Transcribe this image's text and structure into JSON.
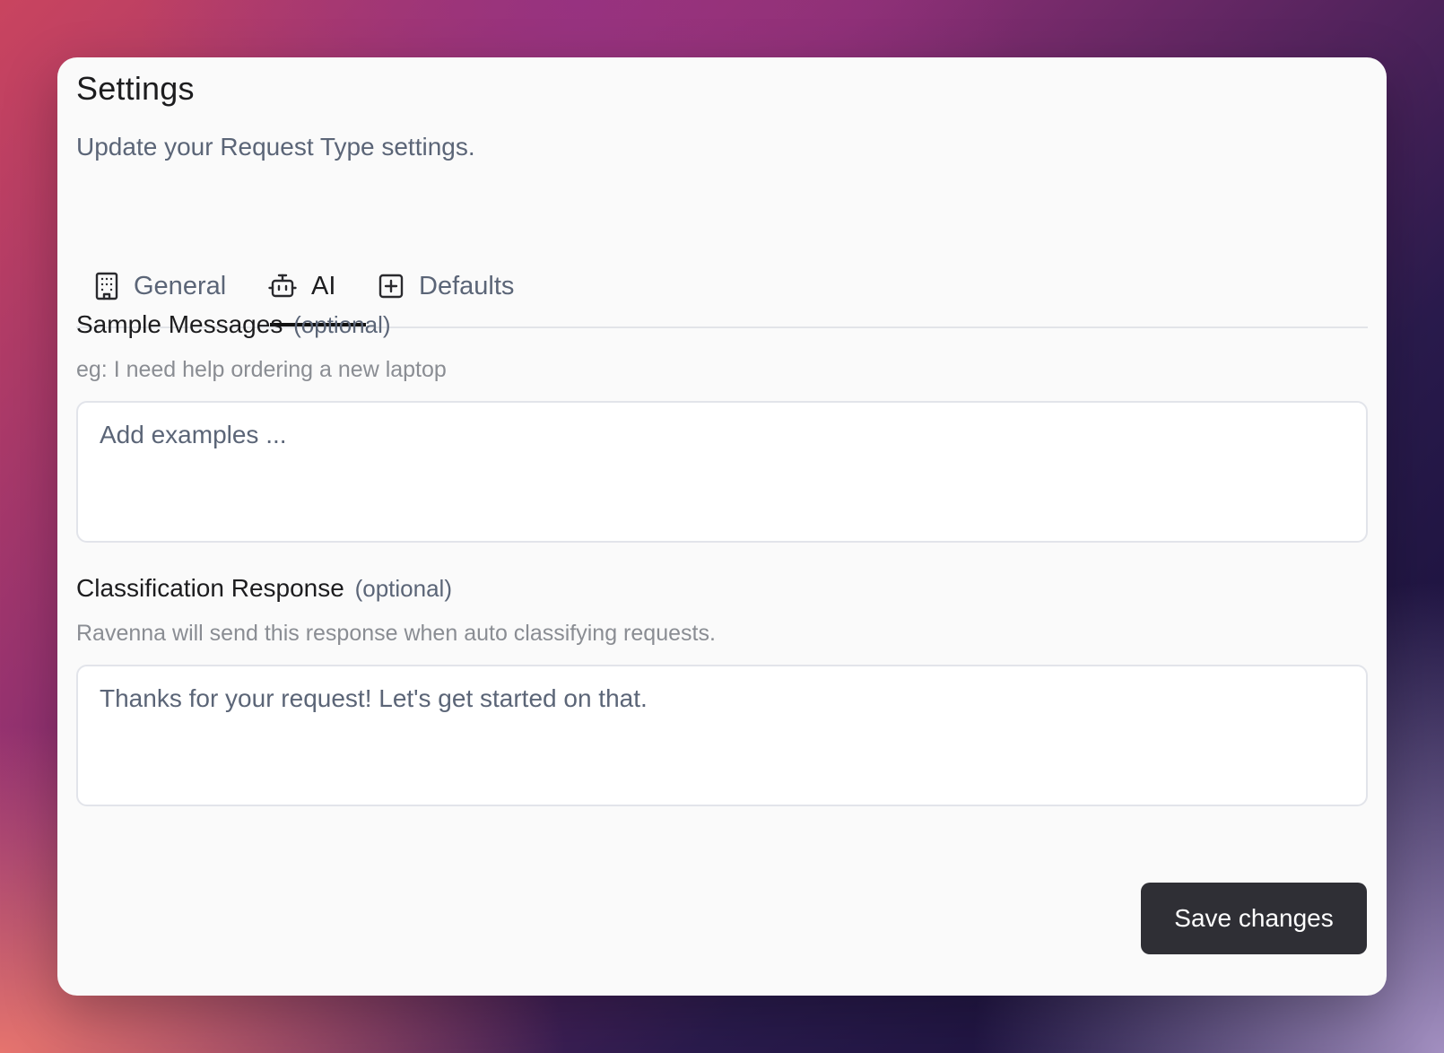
{
  "dialog": {
    "title": "Settings",
    "subtitle": "Update your Request Type settings."
  },
  "tabs": [
    {
      "label": "General",
      "icon": "building-icon",
      "active": false
    },
    {
      "label": "AI",
      "icon": "bot-icon",
      "active": true
    },
    {
      "label": "Defaults",
      "icon": "plus-square-icon",
      "active": false
    }
  ],
  "sample_messages": {
    "label": "Sample Messages",
    "optional": "(optional)",
    "help": "eg: I need help ordering a new laptop",
    "placeholder": "Add examples ...",
    "value": ""
  },
  "classification_response": {
    "label": "Classification Response",
    "optional": "(optional)",
    "help": "Ravenna will send this response when auto classifying requests.",
    "value": "Thanks for your request! Let's get started on that."
  },
  "actions": {
    "save_label": "Save changes"
  },
  "colors": {
    "primary_button": "#2f2f35",
    "muted_text": "#5b6577",
    "card_background": "#fafafa"
  }
}
